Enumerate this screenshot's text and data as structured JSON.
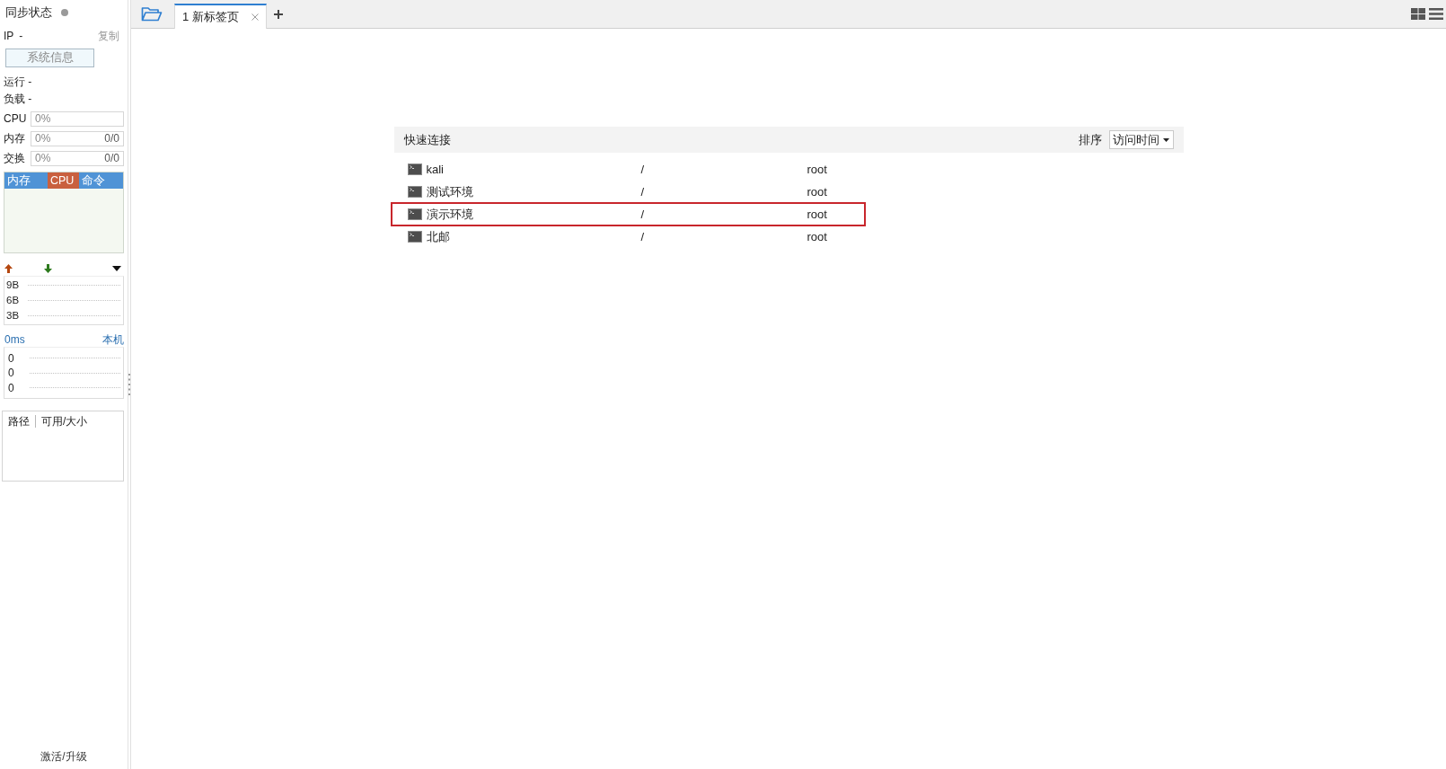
{
  "sidebar": {
    "sync_status": {
      "label": "同步状态"
    },
    "ip": {
      "label": "IP",
      "value": "-",
      "copy_link": "复制"
    },
    "system_info_button": "系统信息",
    "stats": [
      "运行 -",
      "负载 -"
    ],
    "meters": [
      {
        "label": "CPU",
        "percent": "0%"
      },
      {
        "label": "内存",
        "percent": "0%",
        "amount": "0/0"
      },
      {
        "label": "交换",
        "percent": "0%",
        "amount": "0/0"
      }
    ],
    "monitor_tabs": [
      {
        "label": "内存",
        "selected": false
      },
      {
        "label": "CPU",
        "selected": true
      },
      {
        "label": "命令",
        "selected": false
      }
    ],
    "network": {
      "y_ticks": [
        "9B",
        "6B",
        "3B"
      ]
    },
    "latency": {
      "reading": "0ms",
      "host": "本机",
      "y_ticks": [
        "0",
        "0",
        "0"
      ]
    },
    "disk_table": {
      "columns": [
        "路径",
        "可用/大小"
      ]
    },
    "activate_link": "激活/升级"
  },
  "tab_bar": {
    "tabs": [
      {
        "label": "1 新标签页",
        "selected": true
      }
    ]
  },
  "quick_connect": {
    "title": "快速连接",
    "sort_label": "排序",
    "sort_value": "访问时间",
    "connections": [
      {
        "name": "kali",
        "path": "/",
        "user": "root",
        "highlighted": false
      },
      {
        "name": "测试环境",
        "path": "/",
        "user": "root",
        "highlighted": false
      },
      {
        "name": "演示环境",
        "path": "/",
        "user": "root",
        "highlighted": true
      },
      {
        "name": "北邮",
        "path": "/",
        "user": "root",
        "highlighted": false
      }
    ]
  }
}
